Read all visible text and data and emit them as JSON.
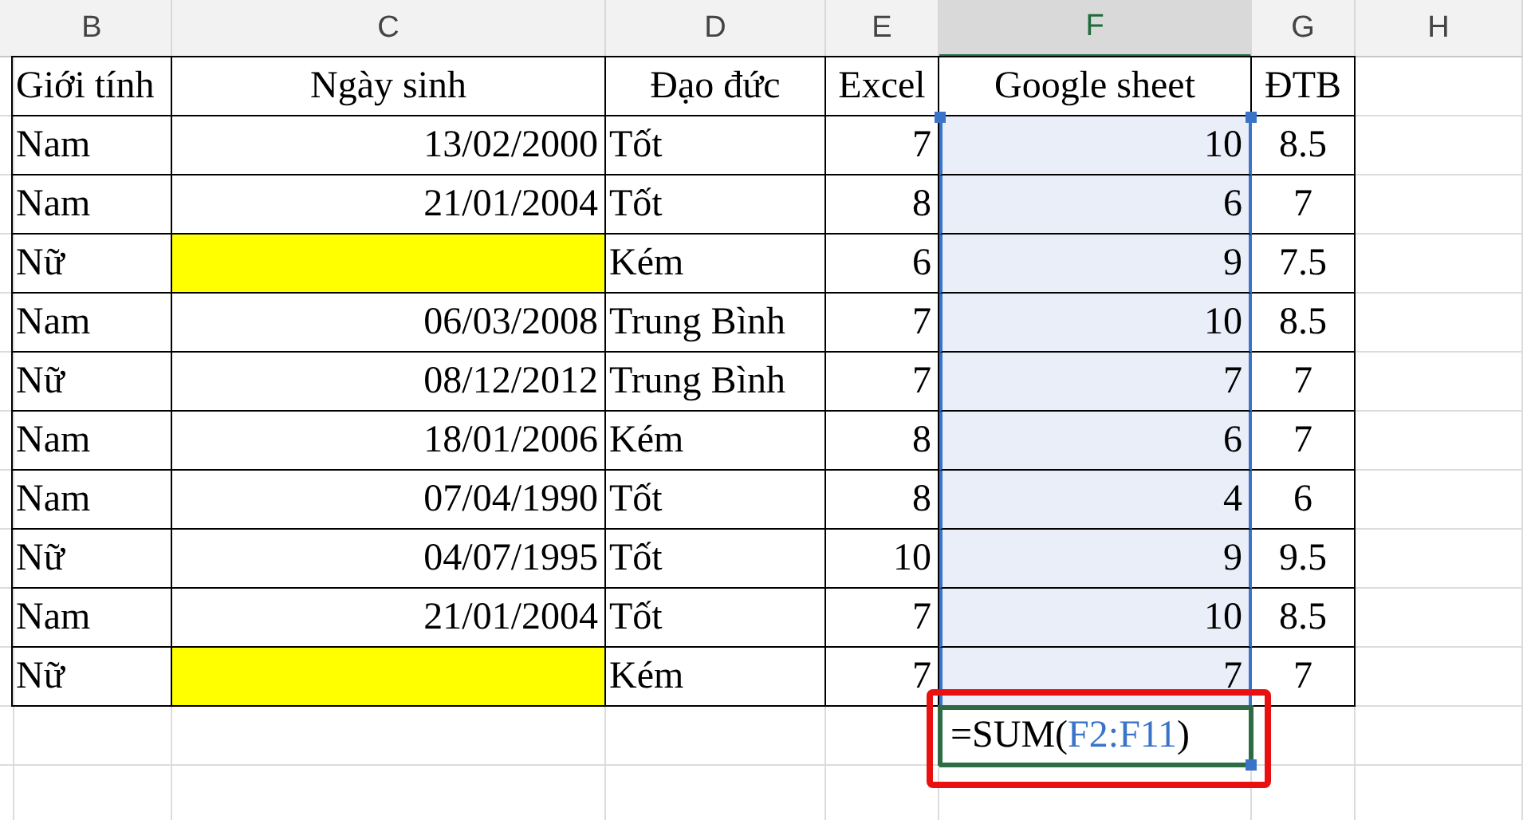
{
  "columns": [
    {
      "letter": "B",
      "selected": false
    },
    {
      "letter": "C",
      "selected": false
    },
    {
      "letter": "D",
      "selected": false
    },
    {
      "letter": "E",
      "selected": false
    },
    {
      "letter": "F",
      "selected": true
    },
    {
      "letter": "G",
      "selected": false
    },
    {
      "letter": "H",
      "selected": false
    }
  ],
  "table": {
    "headers": [
      "Giới tính",
      "Ngày sinh",
      "Đạo đức",
      "Excel",
      "Google sheet",
      "ĐTB"
    ],
    "rows": [
      {
        "gender": "Nam",
        "birth_date": "13/02/2000",
        "conduct": "Tốt",
        "excel": "7",
        "google_sheet": "10",
        "average": "8.5",
        "highlighted": false
      },
      {
        "gender": "Nam",
        "birth_date": "21/01/2004",
        "conduct": "Tốt",
        "excel": "8",
        "google_sheet": "6",
        "average": "7",
        "highlighted": false
      },
      {
        "gender": "Nữ",
        "conduct": "Kém",
        "excel": "6",
        "google_sheet": "9",
        "average": "7.5",
        "highlighted": true
      },
      {
        "gender": "Nam",
        "birth_date": "06/03/2008",
        "conduct": "Trung Bình",
        "excel": "7",
        "google_sheet": "10",
        "average": "8.5",
        "highlighted": false
      },
      {
        "gender": "Nữ",
        "birth_date": "08/12/2012",
        "conduct": "Trung Bình",
        "excel": "7",
        "google_sheet": "7",
        "average": "7",
        "highlighted": false
      },
      {
        "gender": "Nam",
        "birth_date": "18/01/2006",
        "conduct": "Kém",
        "excel": "8",
        "google_sheet": "6",
        "average": "7",
        "highlighted": false
      },
      {
        "gender": "Nam",
        "birth_date": "07/04/1990",
        "conduct": "Tốt",
        "excel": "8",
        "google_sheet": "4",
        "average": "6",
        "highlighted": false
      },
      {
        "gender": "Nữ",
        "birth_date": "04/07/1995",
        "conduct": "Tốt",
        "excel": "10",
        "google_sheet": "9",
        "average": "9.5",
        "highlighted": false
      },
      {
        "gender": "Nam",
        "birth_date": "21/01/2004",
        "conduct": "Tốt",
        "excel": "7",
        "google_sheet": "10",
        "average": "8.5",
        "highlighted": false
      },
      {
        "gender": "Nữ",
        "conduct": "Kém",
        "excel": "7",
        "google_sheet": "7",
        "average": "7",
        "highlighted": true
      }
    ]
  },
  "formula_cell": {
    "prefix": "=SUM(",
    "range": "F2:F11",
    "suffix": ")"
  }
}
